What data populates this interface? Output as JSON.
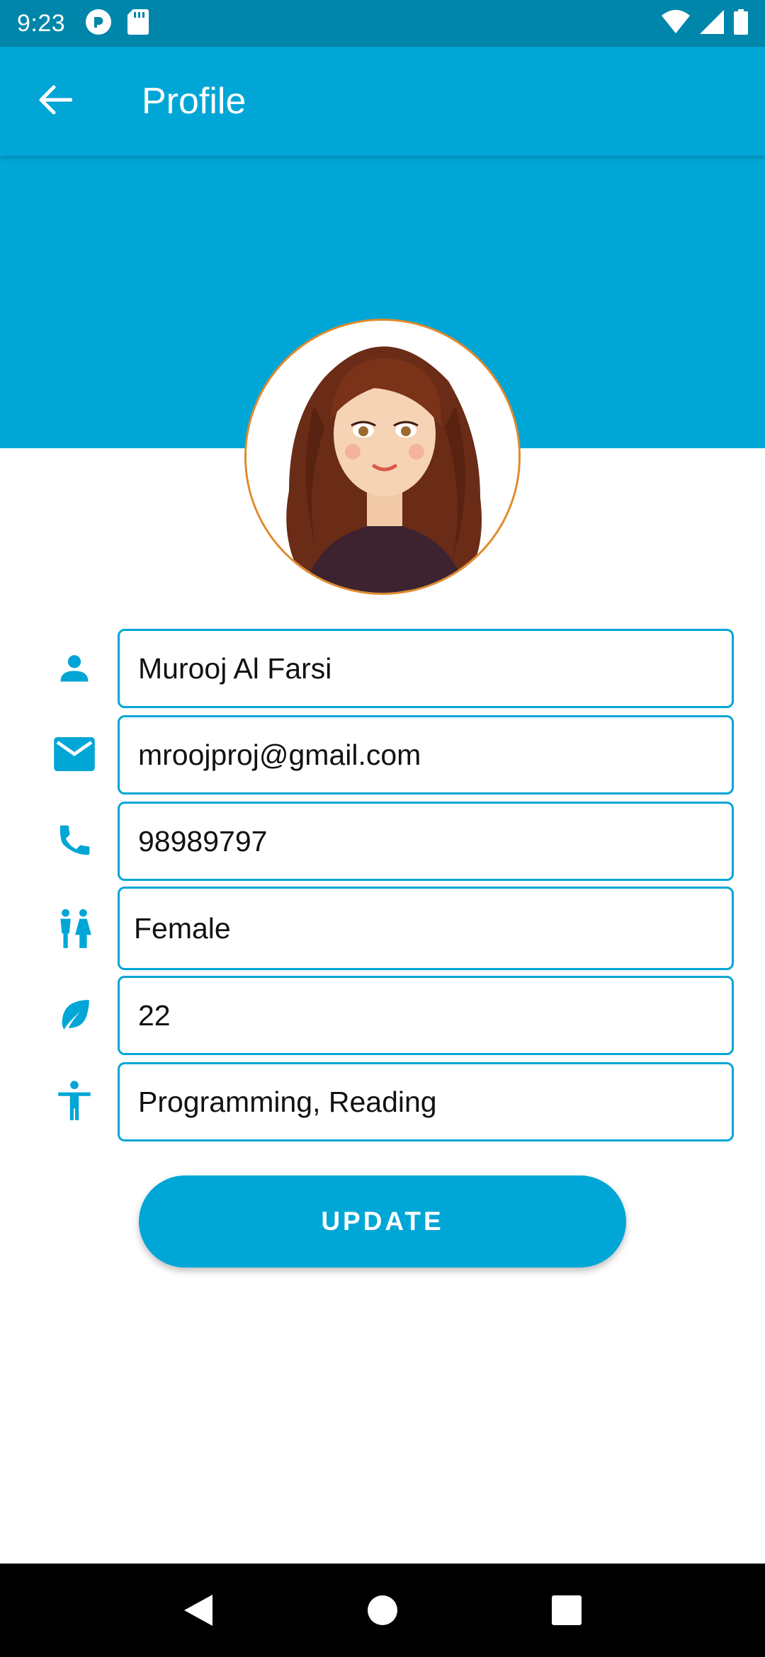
{
  "status_bar": {
    "time": "9:23",
    "left_icons": [
      "pocket-casts-icon",
      "sd-card-icon"
    ],
    "right_icons": [
      "wifi-icon",
      "signal-icon",
      "battery-icon"
    ]
  },
  "app_bar": {
    "title": "Profile",
    "back_icon": "arrow-left-icon"
  },
  "colors": {
    "primary": "#00a6d6",
    "status_bar": "#0086aa",
    "avatar_border": "#e08a2c",
    "nav_bar": "#000000"
  },
  "profile": {
    "name": "Murooj Al Farsi",
    "email": "mroojproj@gmail.com",
    "phone": "98989797",
    "gender": "Female",
    "age": "22",
    "hobbies": "Programming, Reading"
  },
  "buttons": {
    "update_label": "UPDATE"
  },
  "nav": {
    "items": [
      "back-triangle-icon",
      "home-circle-icon",
      "recents-square-icon"
    ]
  }
}
